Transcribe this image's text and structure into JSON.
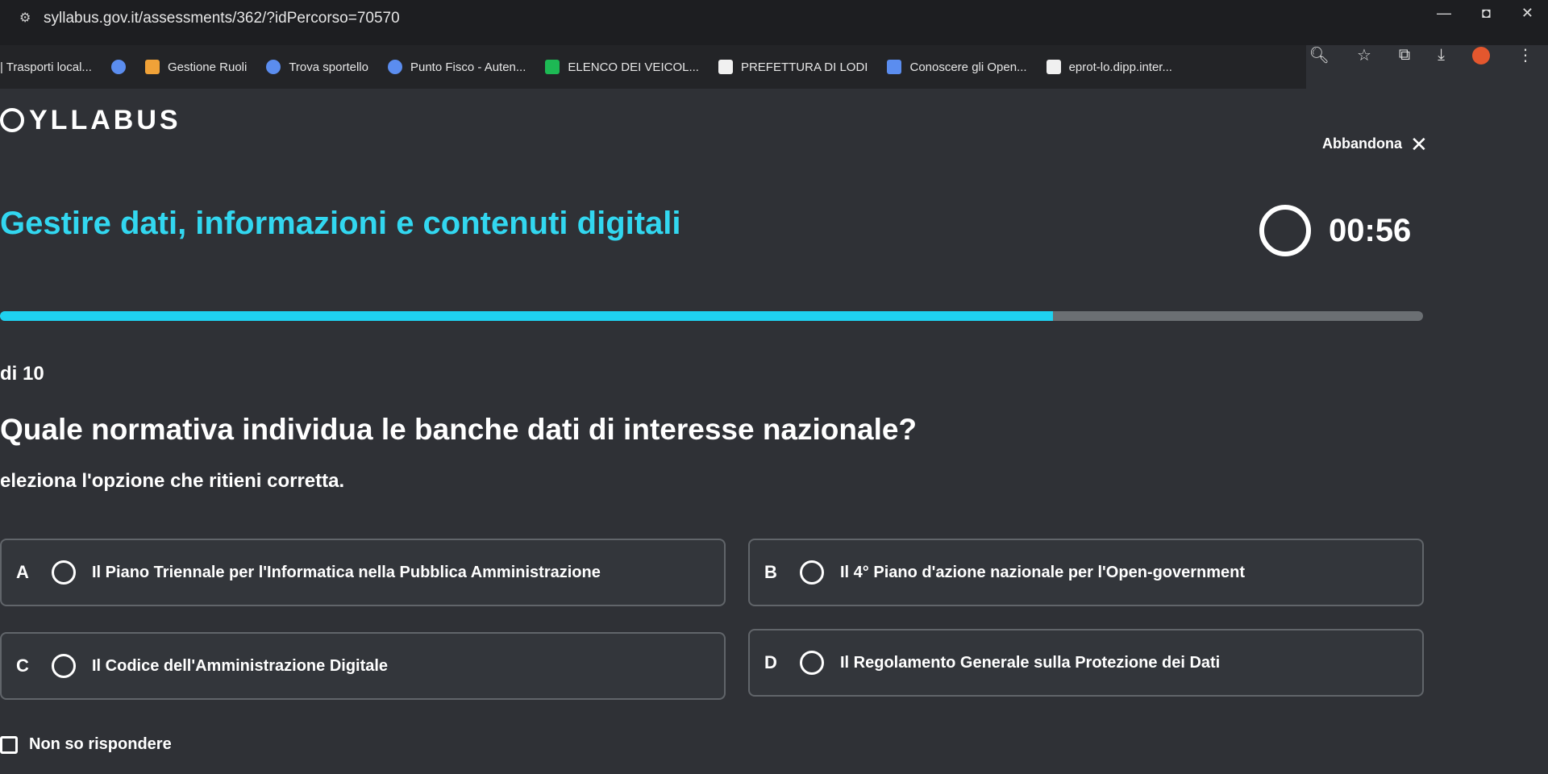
{
  "browser": {
    "url": "syllabus.gov.it/assessments/362/?idPercorso=70570",
    "bookmarks": [
      "| Trasporti local...",
      "Gestione Ruoli",
      "Trova sportello",
      "Punto Fisco - Auten...",
      "ELENCO DEI VEICOL...",
      "PREFETTURA DI LODI",
      "Conoscere gli Open...",
      "eprot-lo.dipp.inter..."
    ],
    "colors": {
      "accent": "#1fd2f0",
      "profile": "#e4572e"
    }
  },
  "app": {
    "logo": "YLLABUS",
    "abbandona": "Abbandona",
    "title": "Gestire dati, informazioni e contenuti digitali",
    "timer": "00:56",
    "progress": 0.74,
    "counter": "di 10",
    "question": "Quale normativa individua le banche dati di interesse nazionale?",
    "instruction": "eleziona l'opzione che ritieni corretta.",
    "options": [
      {
        "letter": "A",
        "text": "Il Piano Triennale per l'Informatica nella Pubblica Amministrazione"
      },
      {
        "letter": "B",
        "text": "Il 4° Piano d'azione nazionale per l'Open-government"
      },
      {
        "letter": "C",
        "text": "Il Codice dell'Amministrazione Digitale"
      },
      {
        "letter": "D",
        "text": "Il Regolamento Generale sulla Protezione dei Dati"
      }
    ],
    "no_answer": "Non so rispondere"
  }
}
